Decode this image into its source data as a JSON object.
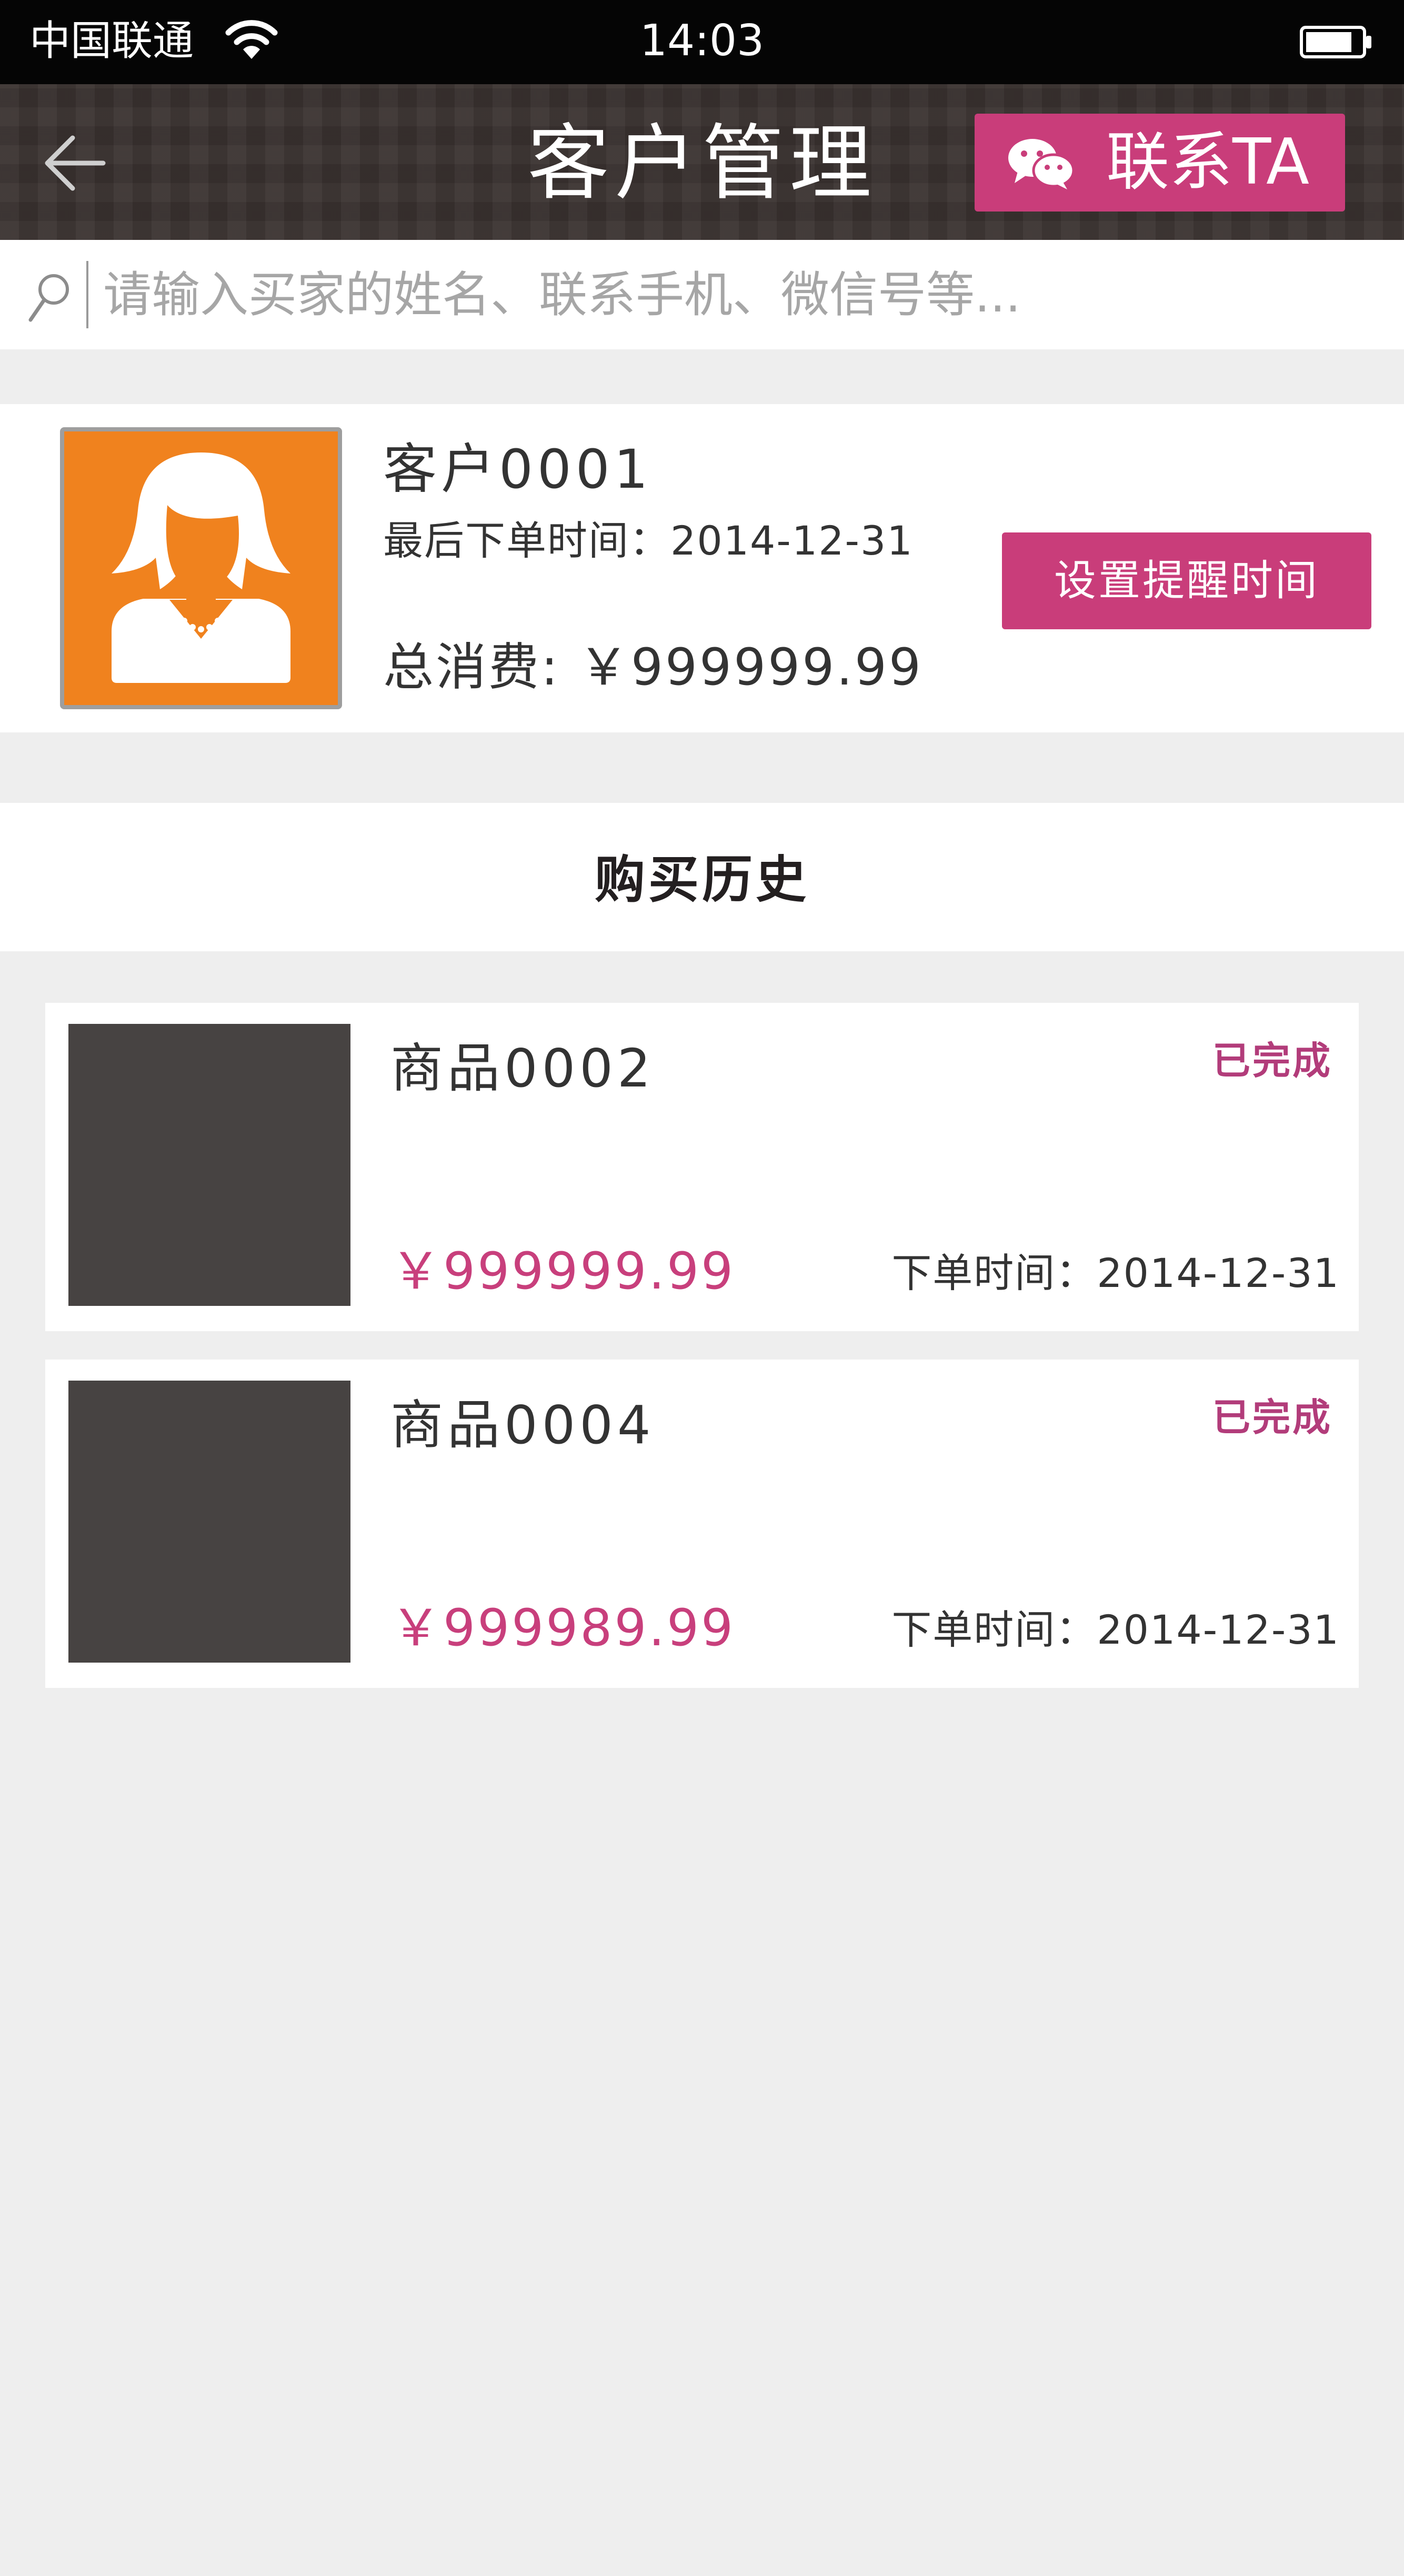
{
  "status_bar": {
    "carrier": "中国联通",
    "time": "14:03",
    "icons": [
      "wifi-icon",
      "battery-icon"
    ]
  },
  "header": {
    "back_icon": "arrow-left-icon",
    "title": "客户管理",
    "contact_button": {
      "icon": "wechat-icon",
      "label": "联系TA"
    }
  },
  "search": {
    "icon": "search-icon",
    "placeholder": "请输入买家的姓名、联系手机、微信号等...",
    "value": ""
  },
  "customer": {
    "avatar_icon": "female-avatar-icon",
    "name": "客户0001",
    "last_order": "最后下单时间：2014-12-31",
    "total_spend": "总消费: ￥999999.99",
    "remind_button": "设置提醒时间"
  },
  "history": {
    "title": "购买历史",
    "orders": [
      {
        "name": "商品0002",
        "status": "已完成",
        "price": "￥999999.99",
        "order_time": "下单时间：2014-12-31"
      },
      {
        "name": "商品0004",
        "status": "已完成",
        "price": "￥999989.99",
        "order_time": "下单时间：2014-12-31"
      }
    ]
  },
  "colors": {
    "accent": "#c93d7a",
    "navbar": "#3b3331",
    "avatar_bg": "#f0821e",
    "status_text": "#b23c7a",
    "price_text": "#c83f7c",
    "page_bg": "#eeeeee"
  }
}
